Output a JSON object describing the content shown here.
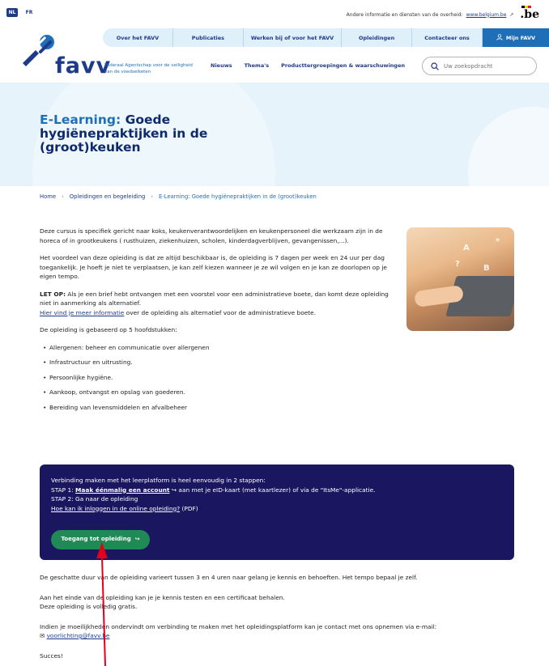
{
  "util": {
    "lang_nl": "NL",
    "lang_fr": "FR",
    "other_info": "Andere informatie en diensten van de overheid:",
    "belgium_link": "www.belgium.be",
    "be_logo": ".be"
  },
  "header": {
    "logo_text": "favv",
    "tagline": "Federaal Agentschap voor de veiligheid van de voedselketen",
    "topnav": [
      "Over het FAVV",
      "Publicaties",
      "Werken bij of voor het FAVV",
      "Opleidingen",
      "Contacteer ons"
    ],
    "mijn": "Mijn FAVV",
    "subnav": [
      "Nieuws",
      "Thema's",
      "Producttergroepingen & waarschuwingen"
    ],
    "search_placeholder": "Uw zoekopdracht"
  },
  "hero": {
    "title_highlight": "E-Learning:",
    "title_rest": " Goede hygiënepraktijken in de (groot)keuken"
  },
  "breadcrumb": {
    "home": "Home",
    "parent": "Opleidingen en begeleiding",
    "current": "E-Learning: Goede hygiënepraktijken in de (groot)keuken"
  },
  "main": {
    "p1": "Deze cursus is specifiek gericht naar koks, keukenverantwoordelijken en keukenpersoneel die werkzaam zijn in de horeca of in grootkeukens ( rusthuizen, ziekenhuizen, scholen, kinderdagverblijven, gevangenissen,...).",
    "p2": "Het voordeel van deze opleiding is dat ze altijd beschikbaar is, de opleiding is 7 dagen per week en 24 uur per dag toegankelijk. Je hoeft je niet te verplaatsen, je kan zelf kiezen wanneer je ze wil volgen en je kan ze doorlopen op je eigen tempo.",
    "let_op_label": "LET OP:",
    "let_op_text": " Als je een brief hebt ontvangen met een voorstel voor een administratieve boete, dan komt deze opleiding niet in aanmerking als alternatief.",
    "more_info_link": "Hier vind je meer informatie",
    "more_info_rest": " over de opleiding als alternatief voor de administratieve boete.",
    "p4": "De opleiding is gebaseerd op 5 hoofdstukken:",
    "chapters": [
      "Allergenen: beheer en communicatie over allergenen",
      "Infrastructuur en uitrusting.",
      "Persoonlijke hygiëne.",
      "Aankoop, ontvangst en opslag van goederen.",
      "Bereiding van levensmiddelen en afvalbeheer"
    ]
  },
  "box": {
    "line1": "Verbinding maken met het leerplatform is heel eenvoudig in 2 stappen:",
    "step1_label": "STAP 1: ",
    "step1_link": "Maak éénmalig een account",
    "step1_rest": " aan met je eID-kaart (met kaartlezer) of via de \"ItsMe\"-applicatie.",
    "step2": "STAP 2: Ga naar de opleiding",
    "login_link": "Hoe kan ik inloggen in de online opleiding?",
    "login_rest": " (PDF)",
    "button": "Toegang tot opleiding"
  },
  "after": {
    "p1": "De geschatte duur van de opleiding varieert tussen 3 en 4 uren naar gelang je kennis en behoeften. Het tempo bepaal je zelf.",
    "p2a": "Aan het einde van de opleiding kan je je kennis testen en een certificaat behalen.",
    "p2b": "Deze opleiding is volledig gratis.",
    "p3": "Indien je moeilijkheden ondervindt om verbinding te maken met het opleidingsplatform kan je contact met ons opnemen via e-mail:",
    "email": "voorlichting@favv.be",
    "p4": "Succes!"
  },
  "colors": {
    "brand_blue": "#1e3a8a",
    "box_bg": "#1a1660",
    "button_green": "#1f8a55",
    "annotation_red": "#e3001b"
  }
}
